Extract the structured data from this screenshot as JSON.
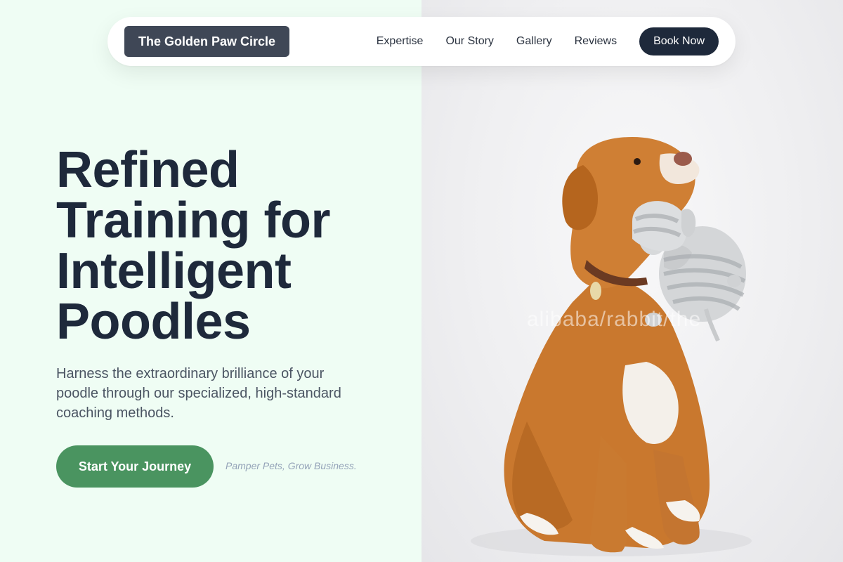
{
  "nav": {
    "logo": "The Golden Paw Circle",
    "links": [
      "Expertise",
      "Our Story",
      "Gallery",
      "Reviews"
    ],
    "cta": "Book Now"
  },
  "hero": {
    "title_lines": [
      "Refined",
      "Training for",
      "Intelligent",
      "Poodles"
    ],
    "subtitle": "Harness the extraordinary brilliance of your poodle through our specialized, high-standard coaching methods.",
    "cta": "Start Your Journey",
    "tagline": "Pamper Pets, Grow Business."
  },
  "image": {
    "subject": "dog-holding-plush-elephant",
    "watermark": "alibaba/rabbit/the"
  },
  "colors": {
    "left_bg": "#effdf4",
    "accent_green": "#4a9460",
    "dark_navy": "#1e293b",
    "logo_bg": "#3f4756"
  }
}
